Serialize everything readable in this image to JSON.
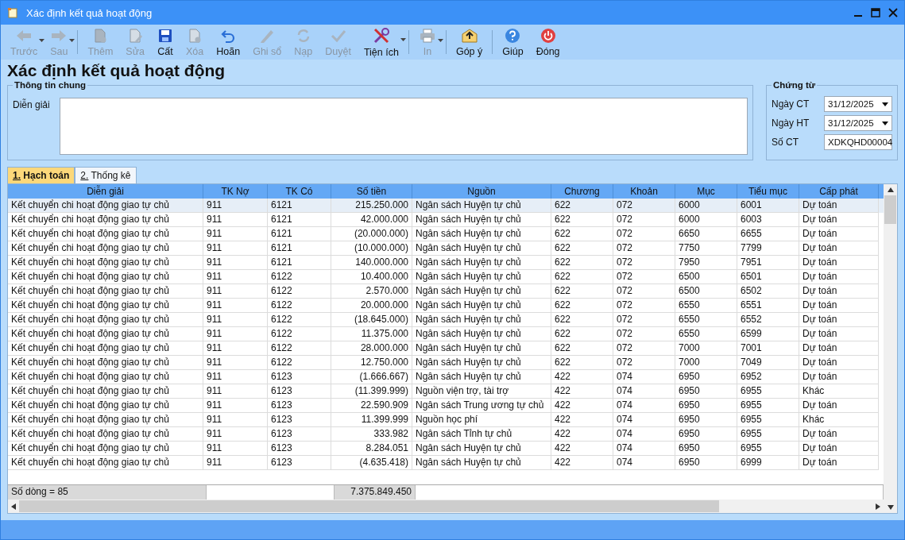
{
  "window": {
    "title": "Xác định kết quả hoạt động"
  },
  "toolbar": {
    "groups": [
      [
        {
          "label": "Trước",
          "enabled": false,
          "dropdown": true
        },
        {
          "label": "Sau",
          "enabled": false,
          "dropdown": true
        }
      ],
      [
        {
          "label": "Thêm",
          "enabled": false,
          "dropdown": false
        },
        {
          "label": "Sửa",
          "enabled": false,
          "dropdown": false
        },
        {
          "label": "Cất",
          "enabled": true,
          "dropdown": false
        },
        {
          "label": "Xóa",
          "enabled": false,
          "dropdown": false
        },
        {
          "label": "Hoãn",
          "enabled": true,
          "dropdown": false
        },
        {
          "label": "Ghi sổ",
          "enabled": false,
          "dropdown": false
        },
        {
          "label": "Nạp",
          "enabled": false,
          "dropdown": false
        },
        {
          "label": "Duyệt",
          "enabled": false,
          "dropdown": false
        },
        {
          "label": "Tiện ích",
          "enabled": true,
          "dropdown": true
        }
      ],
      [
        {
          "label": "In",
          "enabled": false,
          "dropdown": true
        }
      ],
      [
        {
          "label": "Góp ý",
          "enabled": true,
          "dropdown": false
        }
      ],
      [
        {
          "label": "Giúp",
          "enabled": true,
          "dropdown": false
        },
        {
          "label": "Đóng",
          "enabled": true,
          "dropdown": false
        }
      ]
    ]
  },
  "heading": "Xác định kết quả hoạt động",
  "general": {
    "title": "Thông tin chung",
    "description_label": "Diễn giải"
  },
  "voucher": {
    "title": "Chứng từ",
    "fields": [
      {
        "kind": "date",
        "label": "Ngày CT",
        "value": "31/12/2025"
      },
      {
        "kind": "date",
        "label": "Ngày HT",
        "value": "31/12/2025"
      },
      {
        "kind": "text",
        "label": "Số CT",
        "value": "XDKQHD00004"
      }
    ]
  },
  "tabs": [
    {
      "label": "1. Hạch toán",
      "selected": true
    },
    {
      "label": "2. Thống kê",
      "selected": false
    }
  ],
  "table": {
    "columns": [
      "Diễn giải",
      "TK Nợ",
      "TK Có",
      "Số tiền",
      "Nguồn",
      "Chương",
      "Khoản",
      "Mục",
      "Tiểu mục",
      "Cấp phát"
    ],
    "rows": [
      {
        "selected": true,
        "cells": [
          "Kết chuyển chi hoạt động giao tự chủ",
          "911",
          "6121",
          "215.250.000",
          "Ngân sách Huyện tự chủ",
          "622",
          "072",
          "6000",
          "6001",
          "Dự toán"
        ]
      },
      {
        "selected": false,
        "cells": [
          "Kết chuyển chi hoạt động giao tự chủ",
          "911",
          "6121",
          "42.000.000",
          "Ngân sách Huyện tự chủ",
          "622",
          "072",
          "6000",
          "6003",
          "Dự toán"
        ]
      },
      {
        "selected": false,
        "cells": [
          "Kết chuyển chi hoạt động giao tự chủ",
          "911",
          "6121",
          "(20.000.000)",
          "Ngân sách Huyện tự chủ",
          "622",
          "072",
          "6650",
          "6655",
          "Dự toán"
        ]
      },
      {
        "selected": false,
        "cells": [
          "Kết chuyển chi hoạt động giao tự chủ",
          "911",
          "6121",
          "(10.000.000)",
          "Ngân sách Huyện tự chủ",
          "622",
          "072",
          "7750",
          "7799",
          "Dự toán"
        ]
      },
      {
        "selected": false,
        "cells": [
          "Kết chuyển chi hoạt động giao tự chủ",
          "911",
          "6121",
          "140.000.000",
          "Ngân sách Huyện tự chủ",
          "622",
          "072",
          "7950",
          "7951",
          "Dự toán"
        ]
      },
      {
        "selected": false,
        "cells": [
          "Kết chuyển chi hoạt động giao tự chủ",
          "911",
          "6122",
          "10.400.000",
          "Ngân sách Huyện tự chủ",
          "622",
          "072",
          "6500",
          "6501",
          "Dự toán"
        ]
      },
      {
        "selected": false,
        "cells": [
          "Kết chuyển chi hoạt động giao tự chủ",
          "911",
          "6122",
          "2.570.000",
          "Ngân sách Huyện tự chủ",
          "622",
          "072",
          "6500",
          "6502",
          "Dự toán"
        ]
      },
      {
        "selected": false,
        "cells": [
          "Kết chuyển chi hoạt động giao tự chủ",
          "911",
          "6122",
          "20.000.000",
          "Ngân sách Huyện tự chủ",
          "622",
          "072",
          "6550",
          "6551",
          "Dự toán"
        ]
      },
      {
        "selected": false,
        "cells": [
          "Kết chuyển chi hoạt động giao tự chủ",
          "911",
          "6122",
          "(18.645.000)",
          "Ngân sách Huyện tự chủ",
          "622",
          "072",
          "6550",
          "6552",
          "Dự toán"
        ]
      },
      {
        "selected": false,
        "cells": [
          "Kết chuyển chi hoạt động giao tự chủ",
          "911",
          "6122",
          "11.375.000",
          "Ngân sách Huyện tự chủ",
          "622",
          "072",
          "6550",
          "6599",
          "Dự toán"
        ]
      },
      {
        "selected": false,
        "cells": [
          "Kết chuyển chi hoạt động giao tự chủ",
          "911",
          "6122",
          "28.000.000",
          "Ngân sách Huyện tự chủ",
          "622",
          "072",
          "7000",
          "7001",
          "Dự toán"
        ]
      },
      {
        "selected": false,
        "cells": [
          "Kết chuyển chi hoạt động giao tự chủ",
          "911",
          "6122",
          "12.750.000",
          "Ngân sách Huyện tự chủ",
          "622",
          "072",
          "7000",
          "7049",
          "Dự toán"
        ]
      },
      {
        "selected": false,
        "cells": [
          "Kết chuyển chi hoạt động giao tự chủ",
          "911",
          "6123",
          "(1.666.667)",
          "Ngân sách Huyện tự chủ",
          "422",
          "074",
          "6950",
          "6952",
          "Dự toán"
        ]
      },
      {
        "selected": false,
        "cells": [
          "Kết chuyển chi hoạt động giao tự chủ",
          "911",
          "6123",
          "(11.399.999)",
          "Nguồn viện trợ, tài trợ",
          "422",
          "074",
          "6950",
          "6955",
          "Khác"
        ]
      },
      {
        "selected": false,
        "cells": [
          "Kết chuyển chi hoạt động giao tự chủ",
          "911",
          "6123",
          "22.590.909",
          "Ngân sách Trung ương tự chủ",
          "422",
          "074",
          "6950",
          "6955",
          "Dự toán"
        ]
      },
      {
        "selected": false,
        "cells": [
          "Kết chuyển chi hoạt động giao tự chủ",
          "911",
          "6123",
          "11.399.999",
          "Nguồn học phí",
          "422",
          "074",
          "6950",
          "6955",
          "Khác"
        ]
      },
      {
        "selected": false,
        "cells": [
          "Kết chuyển chi hoạt động giao tự chủ",
          "911",
          "6123",
          "333.982",
          "Ngân sách Tỉnh tự chủ",
          "422",
          "074",
          "6950",
          "6955",
          "Dự toán"
        ]
      },
      {
        "selected": false,
        "cells": [
          "Kết chuyển chi hoạt động giao tự chủ",
          "911",
          "6123",
          "8.284.051",
          "Ngân sách Huyện tự chủ",
          "422",
          "074",
          "6950",
          "6955",
          "Dự toán"
        ]
      },
      {
        "selected": false,
        "cells": [
          "Kết chuyển chi hoạt động giao tự chủ",
          "911",
          "6123",
          "(4.635.418)",
          "Ngân sách Huyện tự chủ",
          "422",
          "074",
          "6950",
          "6999",
          "Dự toán"
        ]
      }
    ],
    "footer": {
      "row_count": "Số dòng = 85",
      "total": "7.375.849.450"
    }
  }
}
